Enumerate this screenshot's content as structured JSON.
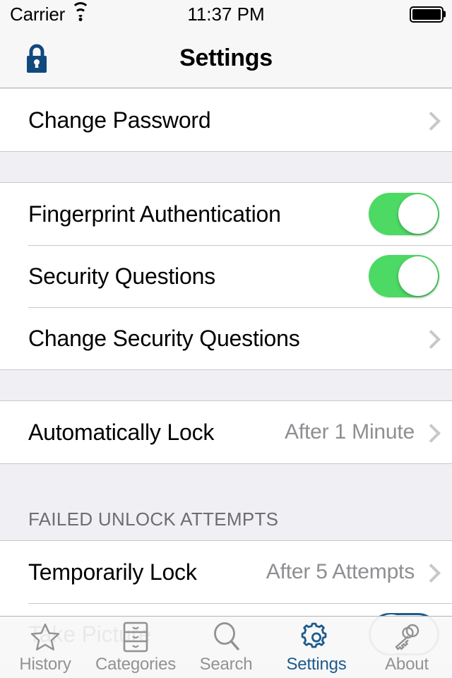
{
  "status_bar": {
    "carrier": "Carrier",
    "wifi_icon": "wifi-icon",
    "time": "11:37 PM",
    "battery_icon": "battery-full-icon"
  },
  "nav_bar": {
    "title": "Settings",
    "left_icon": "lock-icon",
    "lock_color": "#10497E"
  },
  "sections": [
    {
      "header": null,
      "rows": [
        {
          "label": "Change Password",
          "type": "disclosure",
          "value": null
        }
      ]
    },
    {
      "header": null,
      "rows": [
        {
          "label": "Fingerprint Authentication",
          "type": "switch",
          "value": "on"
        },
        {
          "label": "Security Questions",
          "type": "switch",
          "value": "on"
        },
        {
          "label": "Change Security Questions",
          "type": "disclosure",
          "value": null
        }
      ]
    },
    {
      "header": null,
      "rows": [
        {
          "label": "Automatically Lock",
          "type": "disclosure",
          "value": "After 1 Minute"
        }
      ]
    },
    {
      "header": "FAILED UNLOCK ATTEMPTS",
      "rows": [
        {
          "label": "Temporarily Lock",
          "type": "disclosure",
          "value": "After 5 Attempts"
        },
        {
          "label": "Take Picture",
          "type": "switch",
          "value": "off"
        }
      ]
    }
  ],
  "colors": {
    "switch_on": "#4CD964",
    "accent": "#1D5B8D",
    "group_background": "#EFEFF4",
    "row_background": "#FFFFFF",
    "separator": "#C8C7CC",
    "secondary_text": "#8E8E93"
  },
  "tab_bar": {
    "active_index": 3,
    "tabs": [
      {
        "label": "History",
        "icon": "star-icon"
      },
      {
        "label": "Categories",
        "icon": "file-cabinet-icon"
      },
      {
        "label": "Search",
        "icon": "magnifier-icon"
      },
      {
        "label": "Settings",
        "icon": "gear-icon"
      },
      {
        "label": "About",
        "icon": "keys-icon"
      }
    ]
  }
}
